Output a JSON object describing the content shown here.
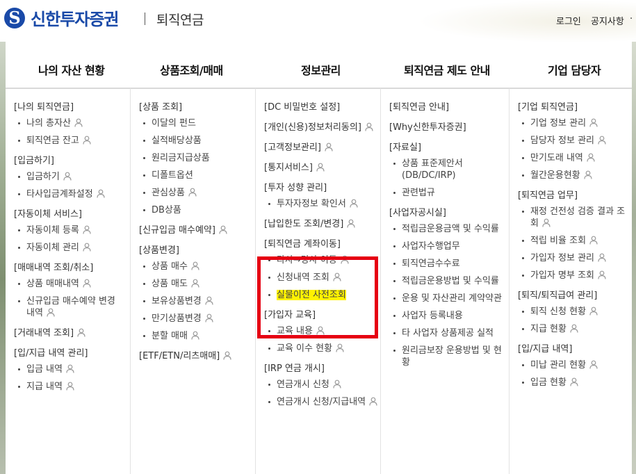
{
  "header": {
    "brand": "신한투자증권",
    "logo_mark": "S",
    "sub_title": "퇴직연금",
    "utility_links": [
      "로그인",
      "공지사항"
    ],
    "utility_more": "·"
  },
  "gnb": [
    "나의 자산 현황",
    "상품조회/매매",
    "정보관리",
    "퇴직연금 제도 안내",
    "기업 담당자"
  ],
  "columns": [
    {
      "sections": [
        {
          "title": "[나의 퇴직연금]",
          "items": [
            {
              "label": "나의 총자산",
              "icon": "person-icon"
            },
            {
              "label": "퇴직연금 잔고",
              "icon": "person-icon"
            }
          ]
        },
        {
          "title": "[입금하기]",
          "items": [
            {
              "label": "입금하기",
              "icon": "person-icon"
            },
            {
              "label": "타사입금계좌설정",
              "icon": "person-icon"
            }
          ]
        },
        {
          "title": "[자동이체 서비스]",
          "items": [
            {
              "label": "자동이체 등록",
              "icon": "person-icon"
            },
            {
              "label": "자동이체 관리",
              "icon": "person-icon"
            }
          ]
        },
        {
          "title": "[매매내역 조회/취소]",
          "items": [
            {
              "label": "상품 매매내역",
              "icon": "person-icon"
            },
            {
              "label": "신규입금 매수예약 변경 내역",
              "icon": "person-icon"
            }
          ]
        },
        {
          "title": "[거래내역 조회]",
          "title_icon": "person-icon",
          "items": []
        },
        {
          "title": "[입/지급 내역 관리]",
          "items": [
            {
              "label": "입금 내역",
              "icon": "person-icon"
            },
            {
              "label": "지급 내역",
              "icon": "person-icon"
            }
          ]
        }
      ]
    },
    {
      "sections": [
        {
          "title": "[상품 조회]",
          "items": [
            {
              "label": "이달의 펀드"
            },
            {
              "label": "실적배당상품"
            },
            {
              "label": "원리금지급상품"
            },
            {
              "label": "디폴트옵션"
            },
            {
              "label": "관심상품",
              "icon": "person-icon"
            },
            {
              "label": "DB상품"
            }
          ]
        },
        {
          "title": "[신규입금 매수예약]",
          "title_icon": "person-icon",
          "items": []
        },
        {
          "title": "[상품변경]",
          "items": [
            {
              "label": "상품 매수",
              "icon": "person-icon"
            },
            {
              "label": "상품 매도",
              "icon": "person-icon"
            },
            {
              "label": "보유상품변경",
              "icon": "person-icon"
            },
            {
              "label": "만기상품변경",
              "icon": "person-icon"
            },
            {
              "label": "분할 매매",
              "icon": "person-icon"
            }
          ]
        },
        {
          "title": "[ETF/ETN/리츠매매]",
          "title_icon": "person-icon",
          "items": []
        }
      ]
    },
    {
      "sections": [
        {
          "title": "[DC 비밀번호 설정]",
          "items": []
        },
        {
          "title": "[개인(신용)정보처리동의]",
          "title_icon": "person-icon",
          "items": []
        },
        {
          "title": "[고객정보관리]",
          "title_icon": "person-icon",
          "items": []
        },
        {
          "title": "[통지서비스]",
          "title_icon": "person-icon",
          "items": []
        },
        {
          "title": "[투자 성향 관리]",
          "items": [
            {
              "label": "투자자정보 확인서",
              "icon": "person-icon"
            }
          ]
        },
        {
          "title": "[납입한도 조회/변경]",
          "title_icon": "person-icon",
          "items": []
        },
        {
          "title": "[퇴직연금 계좌이동]",
          "items": [
            {
              "label": "타사→당사 이동",
              "icon": "person-icon"
            },
            {
              "label": "신청내역 조회",
              "icon": "person-icon"
            },
            {
              "label": "실물이전 사전조회",
              "highlight": true
            }
          ]
        },
        {
          "title": "[가입자 교육]",
          "items": [
            {
              "label": "교육 내용",
              "icon": "person-icon"
            },
            {
              "label": "교육 이수 현황",
              "icon": "person-icon"
            }
          ]
        },
        {
          "title": "[IRP 연금 개시]",
          "items": [
            {
              "label": "연금개시 신청",
              "icon": "person-icon"
            },
            {
              "label": "연금개시 신청/지급내역",
              "icon": "person-icon"
            }
          ]
        }
      ]
    },
    {
      "sections": [
        {
          "title": "[퇴직연금 안내]",
          "items": []
        },
        {
          "title": "[Why신한투자증권]",
          "items": []
        },
        {
          "title": "[자료실]",
          "items": [
            {
              "label": "상품 표준제안서 (DB/DC/IRP)"
            },
            {
              "label": "관련법규"
            }
          ]
        },
        {
          "title": "[사업자공시실]",
          "items": [
            {
              "label": "적립금운용금액 및 수익률"
            },
            {
              "label": "사업자수행업무"
            },
            {
              "label": "퇴직연금수수료"
            },
            {
              "label": "적립금운용방법 및 수익률"
            },
            {
              "label": "운용 및 자산관리 계약약관"
            },
            {
              "label": "사업자 등록내용"
            },
            {
              "label": "타 사업자 상품제공 실적"
            },
            {
              "label": "원리금보장 운용방법 및 현황"
            }
          ]
        }
      ]
    },
    {
      "sections": [
        {
          "title": "[기업 퇴직연금]",
          "items": [
            {
              "label": "기업 정보 관리",
              "icon": "person-icon"
            },
            {
              "label": "담당자 정보 관리",
              "icon": "person-icon"
            },
            {
              "label": "만기도래 내역",
              "icon": "person-icon"
            },
            {
              "label": "월간운용현황",
              "icon": "person-icon"
            }
          ]
        },
        {
          "title": "[퇴직연금 업무]",
          "items": [
            {
              "label": "재정 건전성 검증 결과 조회",
              "icon": "person-icon"
            },
            {
              "label": "적립 비율 조회",
              "icon": "person-icon"
            },
            {
              "label": "가입자 정보 관리",
              "icon": "person-icon"
            },
            {
              "label": "가입자 명부 조회",
              "icon": "person-icon"
            }
          ]
        },
        {
          "title": "[퇴직/퇴직급여 관리]",
          "items": [
            {
              "label": "퇴직 신청 현황",
              "icon": "person-icon"
            },
            {
              "label": "지급 현황",
              "icon": "person-icon"
            }
          ]
        },
        {
          "title": "[입/지급 내역]",
          "items": [
            {
              "label": "미납 관리 현황",
              "icon": "person-icon"
            },
            {
              "label": "입금 현황",
              "icon": "person-icon"
            }
          ]
        }
      ]
    }
  ],
  "colors": {
    "brand": "#1a4aa8",
    "highlight_box": "#e60012",
    "highlight_text_bg": "#fff200"
  }
}
